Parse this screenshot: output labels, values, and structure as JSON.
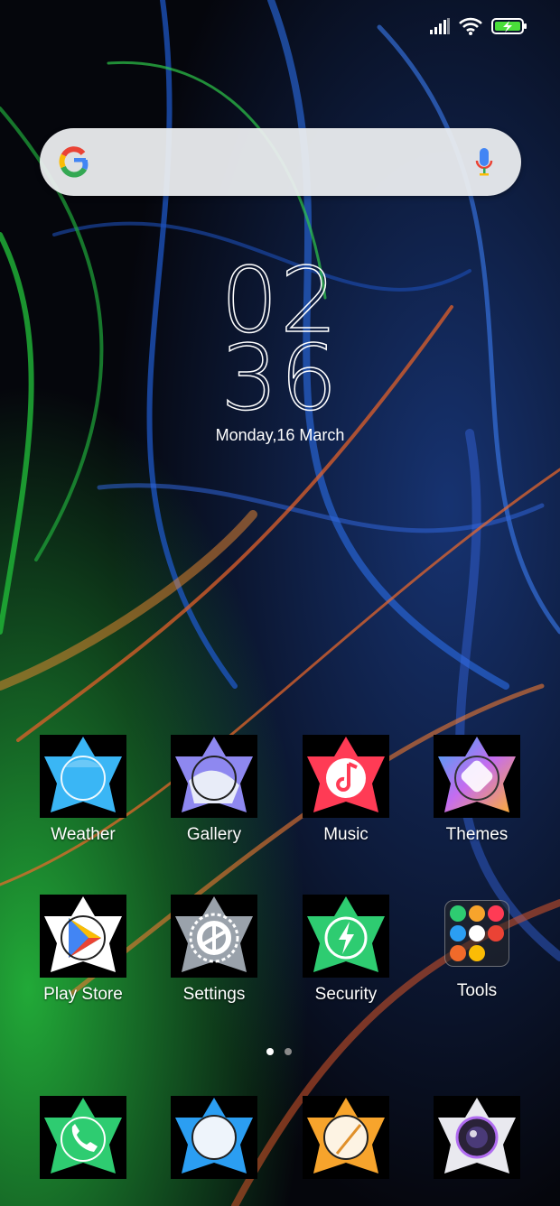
{
  "clock": {
    "hour": "02",
    "minute": "36",
    "date": "Monday,16 March"
  },
  "apps_row1": [
    {
      "label": "Weather",
      "icon": "weather-icon",
      "color": "#3ab6f5"
    },
    {
      "label": "Gallery",
      "icon": "gallery-icon",
      "color": "#8e88f0"
    },
    {
      "label": "Music",
      "icon": "music-icon",
      "color": "#ff3b55"
    },
    {
      "label": "Themes",
      "icon": "themes-icon",
      "color": "#c56cf0"
    }
  ],
  "apps_row2": [
    {
      "label": "Play Store",
      "icon": "play-store-icon",
      "color": "#ffffff"
    },
    {
      "label": "Settings",
      "icon": "settings-icon",
      "color": "#9aa2ab"
    },
    {
      "label": "Security",
      "icon": "security-icon",
      "color": "#2ecc71"
    },
    {
      "label": "Tools",
      "icon": "tools-folder-icon",
      "color": "#444444"
    }
  ],
  "dock": [
    {
      "icon": "phone-icon",
      "color": "#2ecc71"
    },
    {
      "icon": "messages-icon",
      "color": "#2b9ef2"
    },
    {
      "icon": "notes-icon",
      "color": "#f7a42c"
    },
    {
      "icon": "camera-icon",
      "color": "#e9e9ef"
    }
  ],
  "page_indicator": {
    "pages": 2,
    "active": 1
  },
  "colors": {
    "search_bar": "#eceef0",
    "dot_active": "#ffffff",
    "dot_inactive": "#8a8a8a"
  }
}
